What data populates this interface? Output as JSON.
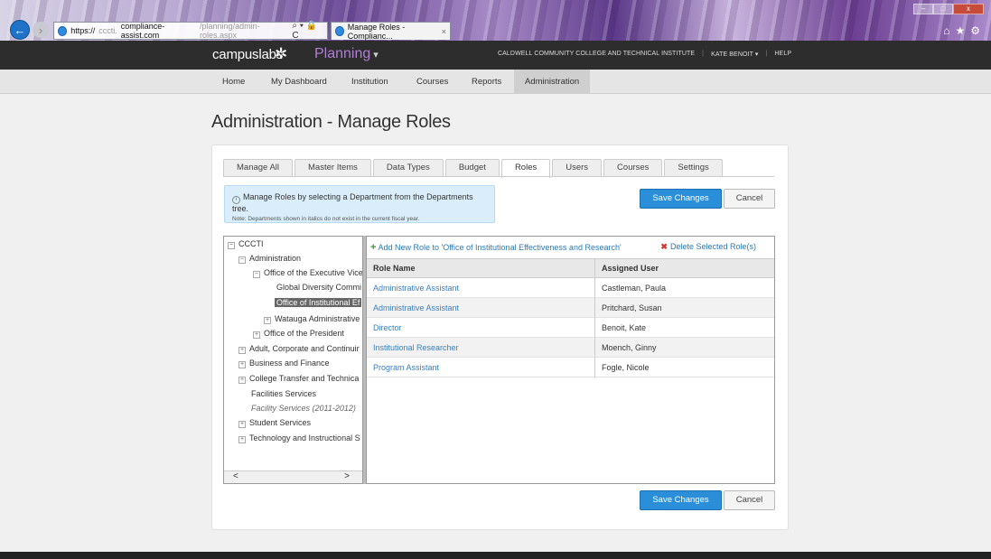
{
  "browser": {
    "url_prefix": "https://",
    "url_host_dim": "cccti.",
    "url_host": "compliance-assist.com",
    "url_path": "/planning/admin-roles.aspx",
    "url_tools": "⌕ ▾ 🔒 C",
    "tab_title": "Manage Roles - Complianc...",
    "tab_close": "×",
    "back_glyph": "←",
    "chrome_icons": "⌂★⚙"
  },
  "header": {
    "brand": "campuslabs",
    "product": "Planning",
    "institution": "CALDWELL COMMUNITY COLLEGE AND TECHNICAL INSTITUTE",
    "user": "KATE BENOIT ▾",
    "help": "HELP"
  },
  "menu": {
    "home": "Home",
    "dashboard": "My Dashboard",
    "institution": "Institution",
    "courses": "Courses",
    "reports": "Reports",
    "administration": "Administration"
  },
  "page_title": "Administration - Manage Roles",
  "tabs": [
    "Manage All",
    "Master Items",
    "Data Types",
    "Budget",
    "Roles",
    "Users",
    "Courses",
    "Settings"
  ],
  "notice": {
    "line1": "Manage Roles by selecting a Department from the Departments tree.",
    "line2": "Note: Departments shown in italics do not exist in the current fiscal year."
  },
  "buttons": {
    "save": "Save Changes",
    "cancel": "Cancel"
  },
  "tree": {
    "root": "CCCTI",
    "administration": "Administration",
    "exec_office": "Office of the Executive Vice",
    "global_diversity": "Global Diversity Commi",
    "institutional_eff": "Office of Institutional Ef",
    "watauga": "Watauga Administrative",
    "president": "Office of the President",
    "adult": "Adult, Corporate and Continuir",
    "business": "Business and Finance",
    "college_transfer": "College Transfer and Technica",
    "facilities": "Facilities Services",
    "facility_2011": "Facility Services (2011-2012)",
    "student": "Student Services",
    "technology": "Technology and Instructional S",
    "scroll_left": "<",
    "scroll_right": ">"
  },
  "grid": {
    "add_link": "Add New Role to 'Office of Institutional Effectiveness and Research'",
    "delete_link": "Delete Selected Role(s)",
    "col_role": "Role Name",
    "col_user": "Assigned User",
    "rows": [
      {
        "role": "Administrative Assistant",
        "user": "Castleman, Paula"
      },
      {
        "role": "Administrative Assistant",
        "user": "Pritchard, Susan"
      },
      {
        "role": "Director",
        "user": "Benoit, Kate"
      },
      {
        "role": "Institutional Researcher",
        "user": "Moench, Ginny"
      },
      {
        "role": "Program Assistant",
        "user": "Fogle, Nicole"
      }
    ]
  }
}
